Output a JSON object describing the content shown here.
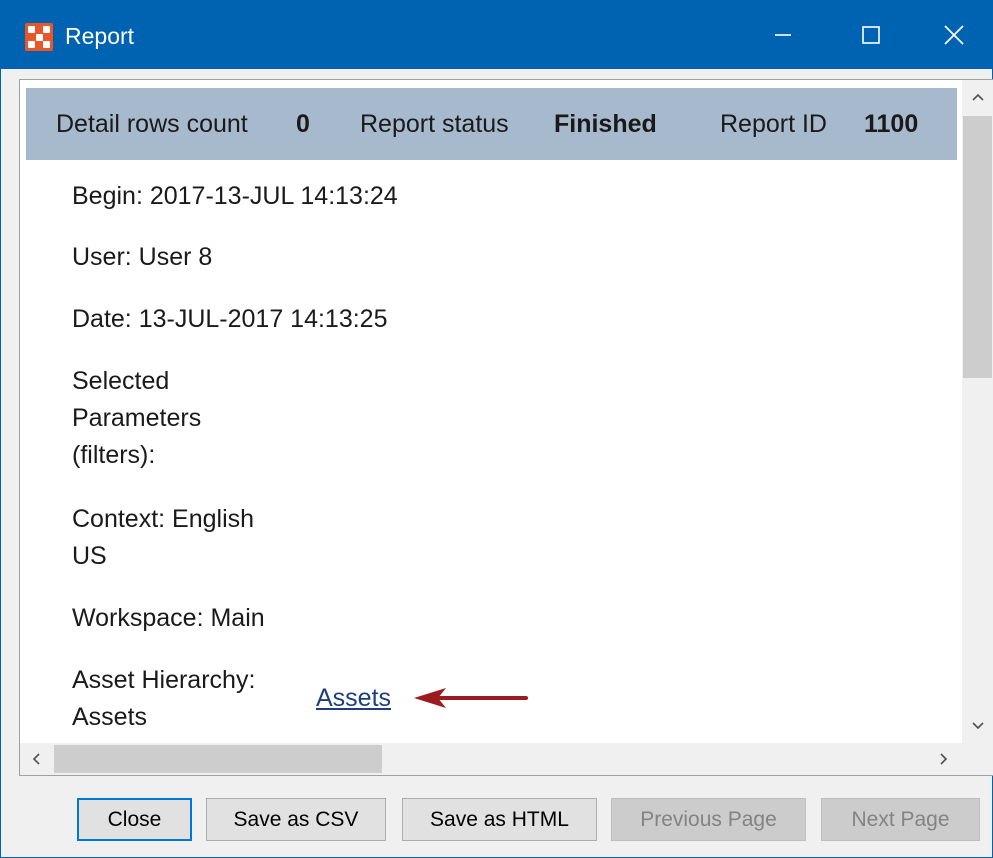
{
  "window": {
    "title": "Report",
    "icon": "app-logo-icon",
    "controls": [
      "minimize-icon",
      "maximize-icon",
      "close-icon"
    ]
  },
  "header": {
    "rows_label": "Detail rows count",
    "rows_value": "0",
    "status_label": "Report status",
    "status_value": "Finished",
    "id_label": "Report ID",
    "id_value": "1100"
  },
  "details": {
    "begin": "Begin: 2017-13-JUL 14:13:24",
    "user": "User: User 8",
    "date": "Date: 13-JUL-2017 14:13:25",
    "selected_1": "Selected",
    "selected_2": "Parameters",
    "selected_3": "(filters):",
    "context_1": "Context: English",
    "context_2": "US",
    "workspace": "Workspace: Main",
    "asset_1": "Asset Hierarchy:",
    "asset_2": "Assets",
    "asset_link": "Assets"
  },
  "buttons": {
    "close": "Close",
    "save_csv": "Save as CSV",
    "save_html": "Save as HTML",
    "previous": "Previous Page",
    "next": "Next Page"
  },
  "colors": {
    "titlebar": "#0063b1",
    "header_band": "#a7b9cc",
    "annotation_arrow": "#9b1b1e",
    "link": "#1f3f7a"
  }
}
